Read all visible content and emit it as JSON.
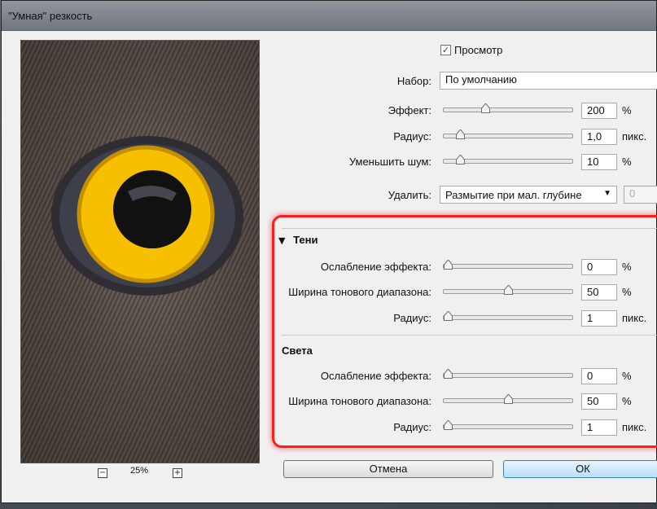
{
  "window": {
    "title": "\"Умная\" резкость"
  },
  "preview": {
    "zoom_level": "25%",
    "zoom_out_icon": "minus-icon",
    "zoom_in_icon": "plus-icon"
  },
  "top": {
    "preview_label": "Просмотр",
    "preview_checked": true,
    "preset_label": "Набор:",
    "preset_value": "По умолчанию",
    "effect_label": "Эффект:",
    "effect_value": "200",
    "effect_unit": "%",
    "effect_level": 0.31,
    "radius_label": "Радиус:",
    "radius_value": "1,0",
    "radius_unit": "пикс.",
    "radius_level": 0.1,
    "noise_label": "Уменьшить шум:",
    "noise_value": "10",
    "noise_unit": "%",
    "noise_level": 0.1,
    "remove_label": "Удалить:",
    "remove_value": "Размытие при мал. глубине",
    "angle_value": "0"
  },
  "shadows": {
    "title": "Тени",
    "fade_label": "Ослабление эффекта:",
    "fade_value": "0",
    "fade_unit": "%",
    "fade_level": 0.0,
    "tonal_label": "Ширина тонового диапазона:",
    "tonal_value": "50",
    "tonal_unit": "%",
    "tonal_level": 0.5,
    "radius_label": "Радиус:",
    "radius_value": "1",
    "radius_unit": "пикс.",
    "radius_level": 0.0
  },
  "highlights": {
    "title": "Света",
    "fade_label": "Ослабление эффекта:",
    "fade_value": "0",
    "fade_unit": "%",
    "fade_level": 0.0,
    "tonal_label": "Ширина тонового диапазона:",
    "tonal_value": "50",
    "tonal_unit": "%",
    "tonal_level": 0.5,
    "radius_label": "Радиус:",
    "radius_value": "1",
    "radius_unit": "пикс.",
    "radius_level": 0.0
  },
  "buttons": {
    "cancel_label": "Отмена",
    "ok_label": "ОК"
  },
  "colors": {
    "highlight_box": "#ff1c1c",
    "iris": "#f6c000"
  }
}
